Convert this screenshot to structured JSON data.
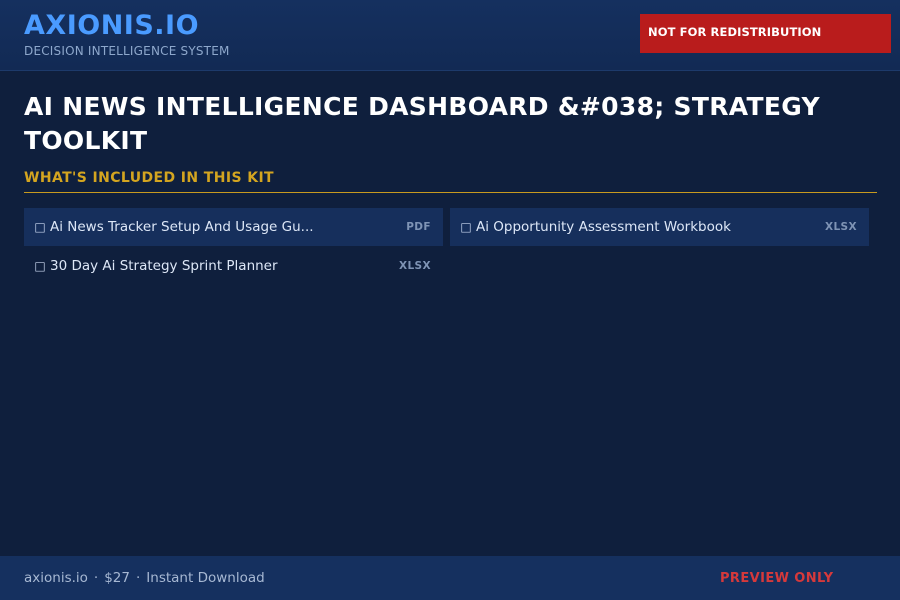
{
  "header": {
    "brand": "AXIONIS.IO",
    "subtitle": "DECISION INTELLIGENCE SYSTEM",
    "badge": "NOT FOR REDISTRIBUTION"
  },
  "main": {
    "title": "AI NEWS INTELLIGENCE DASHBOARD &#038; STRATEGY TOOLKIT",
    "section_heading": "WHAT'S INCLUDED IN THIS KIT",
    "items": [
      {
        "icon": "file-icon",
        "label": "Ai News Tracker Setup And Usage Gu...",
        "type": "PDF"
      },
      {
        "icon": "file-icon",
        "label": "Ai Opportunity Assessment Workbook",
        "type": "XLSX"
      },
      {
        "icon": "file-icon",
        "label": "30 Day Ai Strategy Sprint Planner",
        "type": "XLSX"
      }
    ]
  },
  "footer": {
    "domain": "axionis.io",
    "separator": "·",
    "price": "$27",
    "delivery": "Instant Download",
    "status": "PREVIEW ONLY"
  },
  "colors": {
    "background": "#0f1f3d",
    "brand": "#4a9bff",
    "badge": "#b91c1c",
    "section_accent": "#d4a520",
    "preview_red": "#d6393b"
  }
}
